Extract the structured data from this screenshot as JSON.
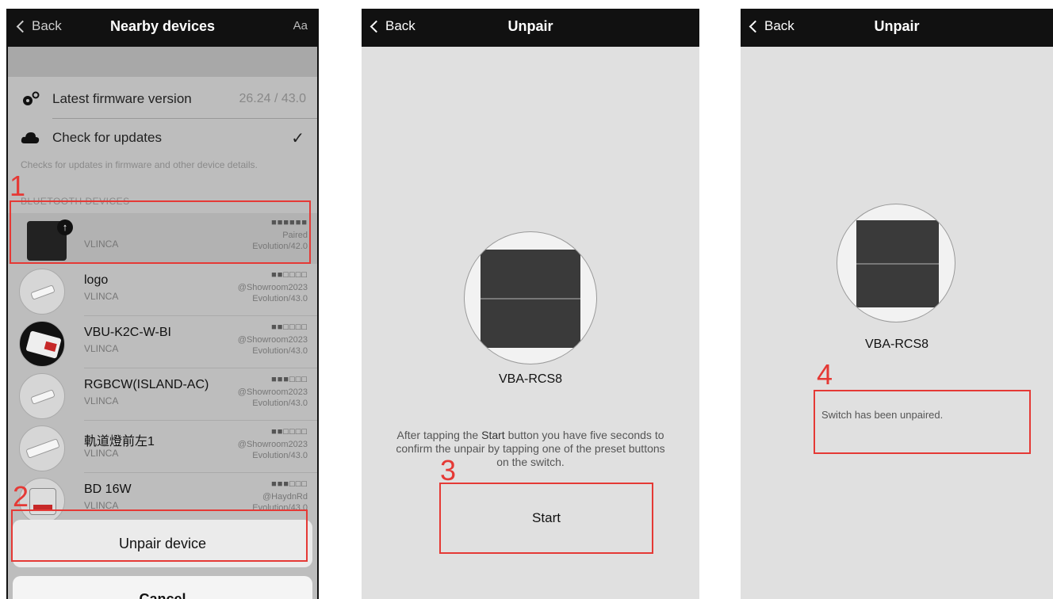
{
  "screen1": {
    "nav": {
      "back": "Back",
      "title": "Nearby devices",
      "aa": "Aa"
    },
    "firmware": {
      "label": "Latest firmware version",
      "value": "26.24 / 43.0"
    },
    "updates": {
      "label": "Check for updates",
      "check": "✓"
    },
    "hint": "Checks for updates in firmware and other device details.",
    "section": "BLUETOOTH DEVICES",
    "devices": [
      {
        "name": "",
        "brand": "VLINCA",
        "signal": "■■■■■■",
        "line2": "Paired",
        "line3": "Evolution/42.0"
      },
      {
        "name": "logo",
        "brand": "VLINCA",
        "signal": "■■□□□□",
        "line2": "@Showroom2023",
        "line3": "Evolution/43.0"
      },
      {
        "name": "VBU-K2C-W-BI",
        "brand": "VLINCA",
        "signal": "■■□□□□",
        "line2": "@Showroom2023",
        "line3": "Evolution/43.0"
      },
      {
        "name": "RGBCW(ISLAND-AC)",
        "brand": "VLINCA",
        "signal": "■■■□□□",
        "line2": "@Showroom2023",
        "line3": "Evolution/43.0"
      },
      {
        "name": "軌道燈前左1",
        "brand": "VLINCA",
        "signal": "■■□□□□",
        "line2": "@Showroom2023",
        "line3": "Evolution/43.0"
      },
      {
        "name": "BD 16W",
        "brand": "VLINCA",
        "signal": "■■■□□□",
        "line2": "@HaydnRd",
        "line3": "Evolution/43.0"
      }
    ],
    "unpair": "Unpair device",
    "cancel": "Cancel",
    "steps": {
      "one": "1",
      "two": "2"
    }
  },
  "screen2": {
    "nav": {
      "back": "Back",
      "title": "Unpair"
    },
    "device": "VBA-RCS8",
    "instr_a": "After tapping the ",
    "instr_b": "Start",
    "instr_c": " button you have five seconds to confirm the unpair by tapping one of the preset buttons on the switch.",
    "start": "Start",
    "step": "3"
  },
  "screen3": {
    "nav": {
      "back": "Back",
      "title": "Unpair"
    },
    "device": "VBA-RCS8",
    "message": "Switch has been unpaired.",
    "step": "4"
  },
  "colors": {
    "highlight": "#e53935",
    "navbar": "#111111"
  }
}
